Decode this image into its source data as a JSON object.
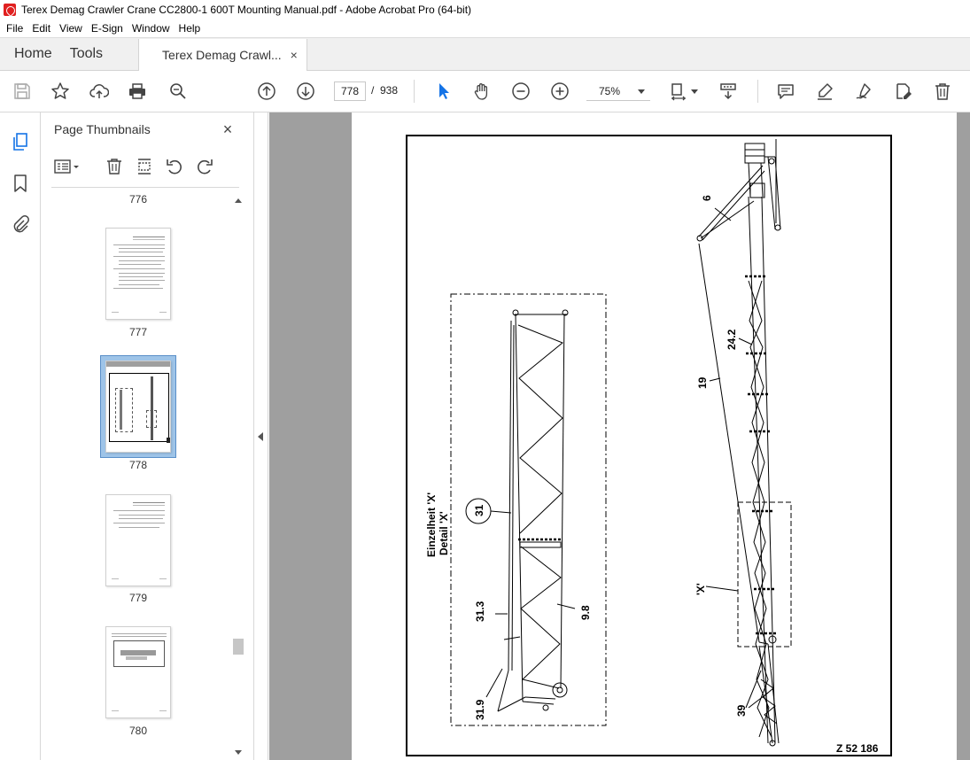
{
  "window": {
    "title": "Terex Demag Crawler Crane CC2800-1 600T Mounting Manual.pdf - Adobe Acrobat Pro (64-bit)"
  },
  "menu": [
    "File",
    "Edit",
    "View",
    "E-Sign",
    "Window",
    "Help"
  ],
  "tabs": {
    "home": "Home",
    "tools": "Tools",
    "document": "Terex Demag Crawl...",
    "close_glyph": "×"
  },
  "toolbar": {
    "current_page": "778",
    "page_separator": "/",
    "total_pages": "938",
    "zoom": "75%"
  },
  "thumbnails_panel": {
    "title": "Page Thumbnails",
    "close_glyph": "×",
    "labels": [
      "776",
      "777",
      "778",
      "779",
      "780"
    ],
    "selected_page": "778"
  },
  "drawing": {
    "labels": {
      "callout_6": "6",
      "callout_24_2": "24.2",
      "callout_19": "19",
      "callout_x": "'X'",
      "callout_39": "39",
      "detail_de": "Einzelheit 'X'",
      "detail_en": "Detail 'X'",
      "callout_31": "31",
      "callout_31_3": "31.3",
      "callout_9_8": "9.8",
      "callout_31_9": "31.9",
      "drawing_number": "Z 52 186"
    }
  },
  "colors": {
    "accent_blue": "#1473e6",
    "canvas_gray": "#9f9f9f",
    "app_red": "#e02020"
  }
}
